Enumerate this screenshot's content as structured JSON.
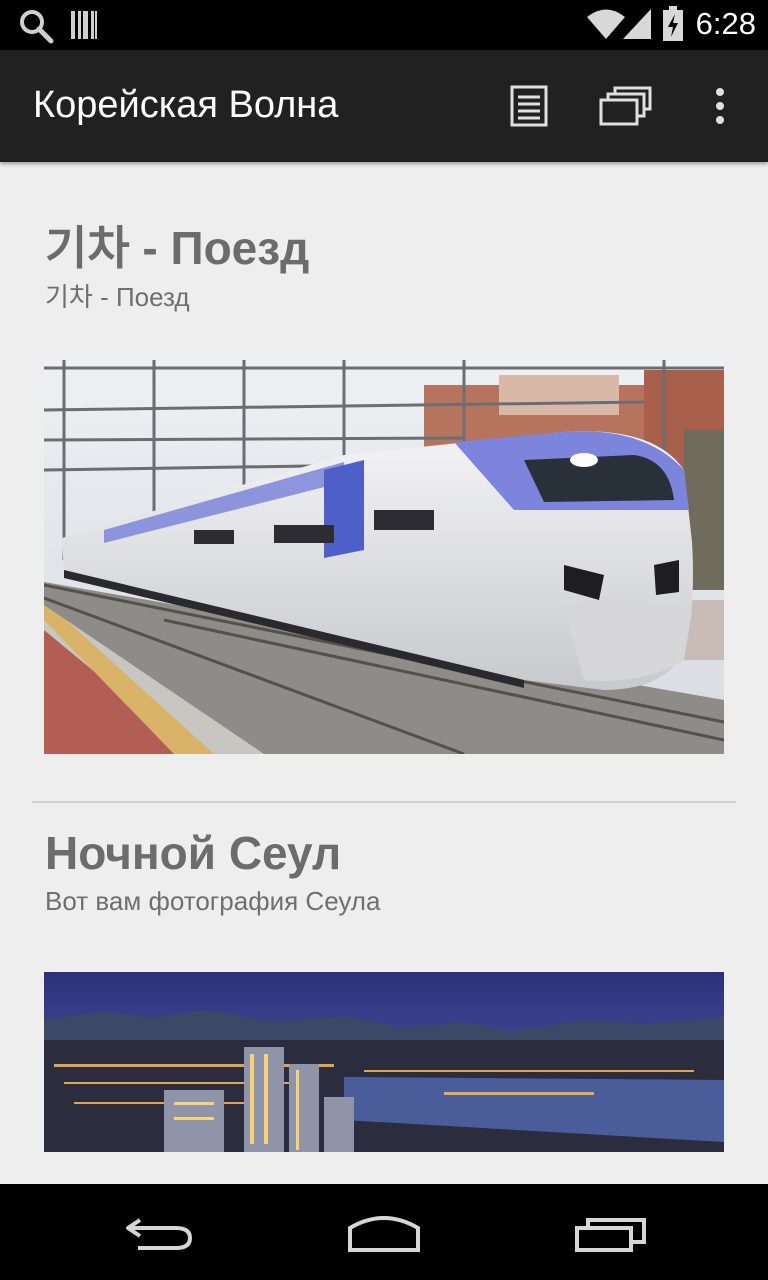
{
  "status_bar": {
    "time": "6:28",
    "icons": [
      "search-icon",
      "barcode-icon",
      "wifi-icon",
      "signal-icon",
      "battery-icon"
    ]
  },
  "action_bar": {
    "title": "Корейская Волна",
    "actions": [
      "list-view-icon",
      "gallery-view-icon",
      "overflow-menu-icon"
    ]
  },
  "cards": [
    {
      "title": "기차 - Поезд",
      "subtitle": "기차 - Поезд",
      "image": "train-photo"
    },
    {
      "title": "Ночной Сеул",
      "subtitle": "Вот вам фотография Сеула",
      "image": "seoul-night-photo"
    }
  ],
  "nav_bar": {
    "buttons": [
      "back-icon",
      "home-icon",
      "recent-apps-icon"
    ]
  },
  "colors": {
    "status_bar": "#000000",
    "action_bar": "#212121",
    "background": "#eeeeee",
    "title_text": "#6c6c6c"
  }
}
